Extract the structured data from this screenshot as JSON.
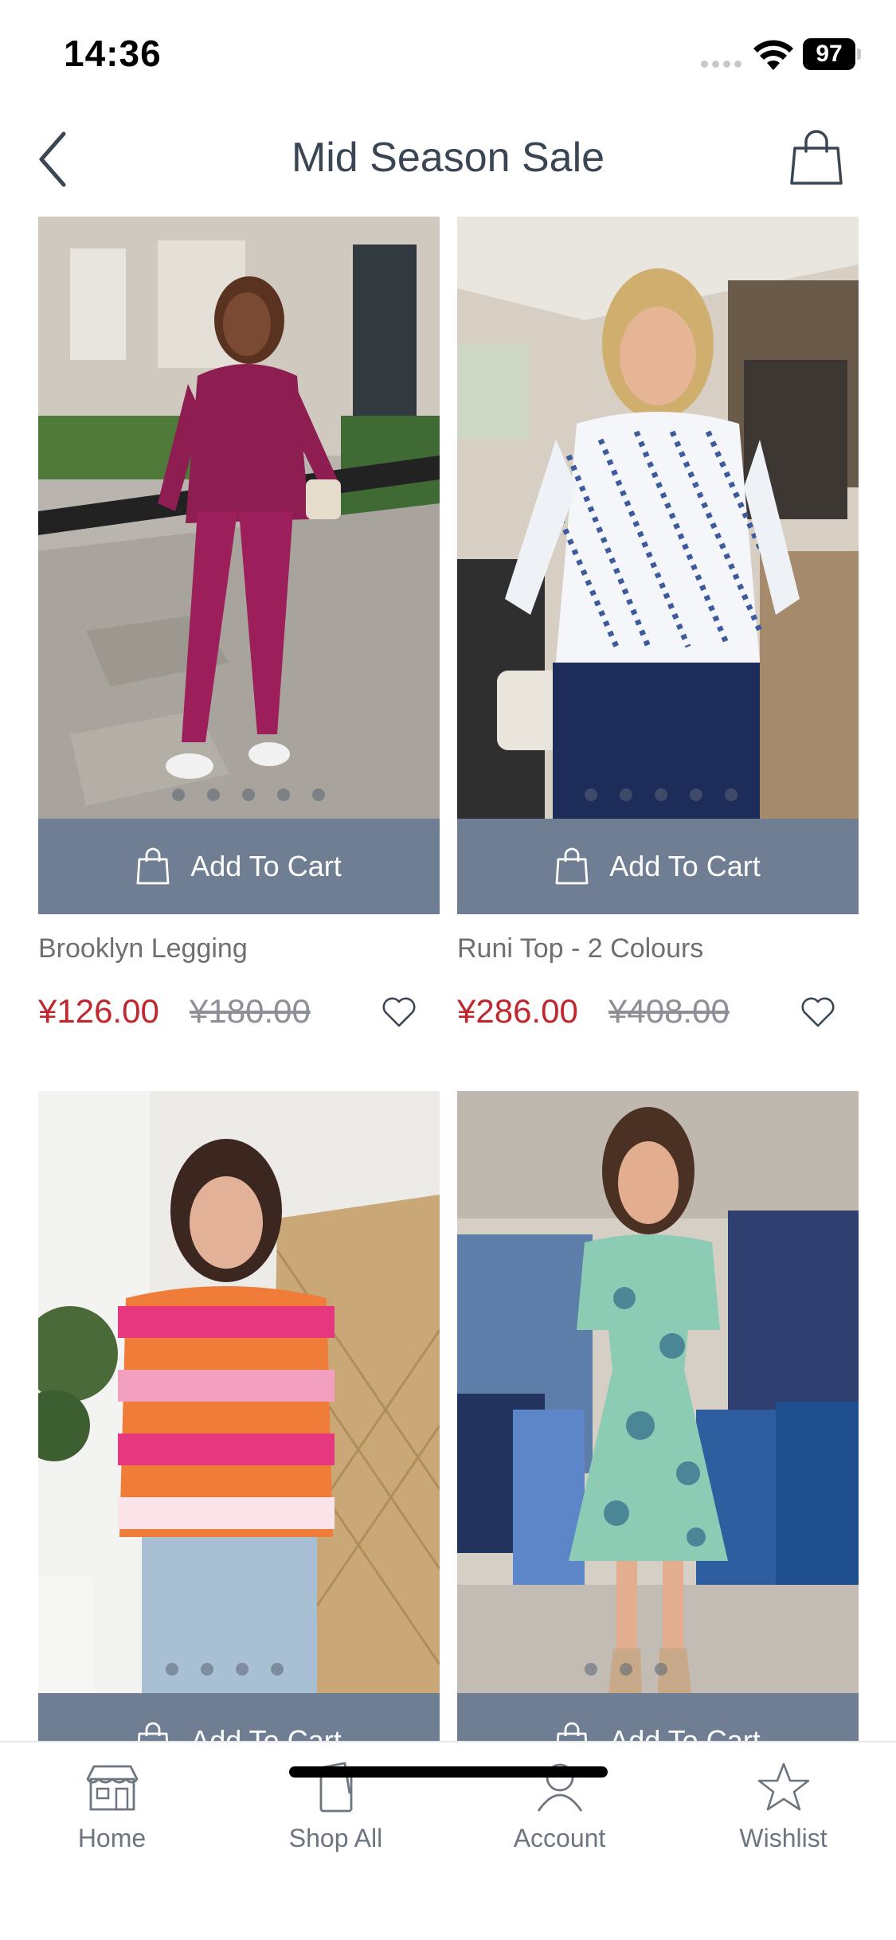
{
  "status_bar": {
    "time": "14:36",
    "battery": "97"
  },
  "header": {
    "title": "Mid Season Sale"
  },
  "products": [
    {
      "name": "Brooklyn Legging",
      "sale_price": "¥126.00",
      "original_price": "¥180.00",
      "cart_label": "Add To Cart"
    },
    {
      "name": "Runi Top - 2 Colours",
      "sale_price": "¥286.00",
      "original_price": "¥408.00",
      "cart_label": "Add To Cart"
    },
    {
      "name": "",
      "sale_price": "",
      "original_price": "",
      "cart_label": "Add To Cart"
    },
    {
      "name": "",
      "sale_price": "",
      "original_price": "",
      "cart_label": "Add To Cart"
    }
  ],
  "tab_bar": {
    "items": [
      {
        "label": "Home",
        "icon": "store-icon"
      },
      {
        "label": "Shop All",
        "icon": "cards-icon"
      },
      {
        "label": "Account",
        "icon": "person-icon"
      },
      {
        "label": "Wishlist",
        "icon": "star-icon"
      }
    ]
  },
  "colors": {
    "accent_button": "#6f7e92",
    "sale_price": "#c0272d",
    "title_text": "#3a4654"
  }
}
